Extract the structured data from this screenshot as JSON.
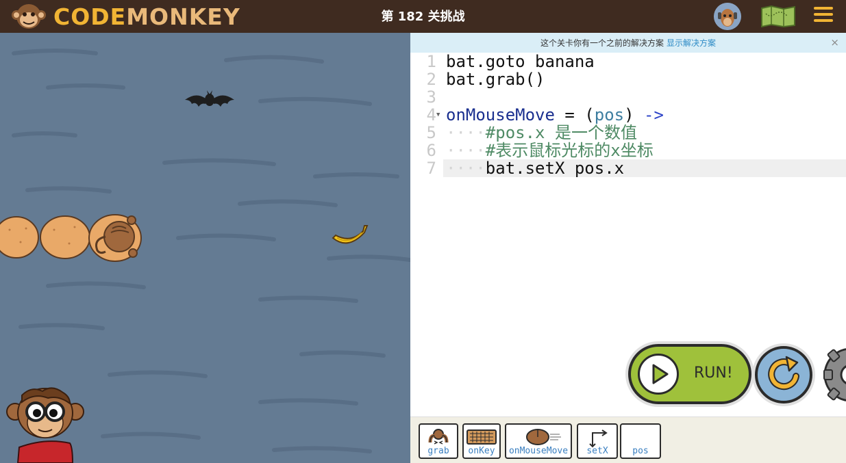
{
  "header": {
    "logo_part1": "CODE",
    "logo_part2": "MONKEY",
    "title": "第 182 关挑战"
  },
  "notice": {
    "text": "这个关卡你有一个之前的解决方案",
    "link": "显示解决方案",
    "close": "×"
  },
  "editor": {
    "lines": [
      {
        "num": "1",
        "text": "bat.goto banana"
      },
      {
        "num": "2",
        "text": "bat.grab()"
      },
      {
        "num": "3",
        "text": ""
      },
      {
        "num": "4",
        "fn": "onMouseMove",
        "eq": " = (",
        "arg": "pos",
        "close": ") ",
        "arrow": "->"
      },
      {
        "num": "5",
        "indent": "····",
        "comment": "#pos.x 是一个数值"
      },
      {
        "num": "6",
        "indent": "····",
        "comment": "#表示鼠标光标的x坐标"
      },
      {
        "num": "7",
        "indent": "····",
        "text": "bat.setX pos.x"
      }
    ]
  },
  "controls": {
    "run_label": "RUN!"
  },
  "toolbox": {
    "items": [
      "grab",
      "onKey",
      "onMouseMove",
      "setX",
      "pos"
    ]
  },
  "colors": {
    "header_bg": "#3f2b20",
    "logo_yellow": "#f1b434",
    "water": "#647b93",
    "run_green": "#9fc13b",
    "reset_blue": "#8bb4d6",
    "toolbox_label": "#3a7fc0"
  },
  "icons": [
    "monkey-logo-icon",
    "avatar-icon",
    "map-icon",
    "menu-icon",
    "play-icon",
    "reset-icon",
    "gear-icon",
    "bat-icon",
    "banana-icon",
    "monkey-icon",
    "coconut-icon"
  ]
}
